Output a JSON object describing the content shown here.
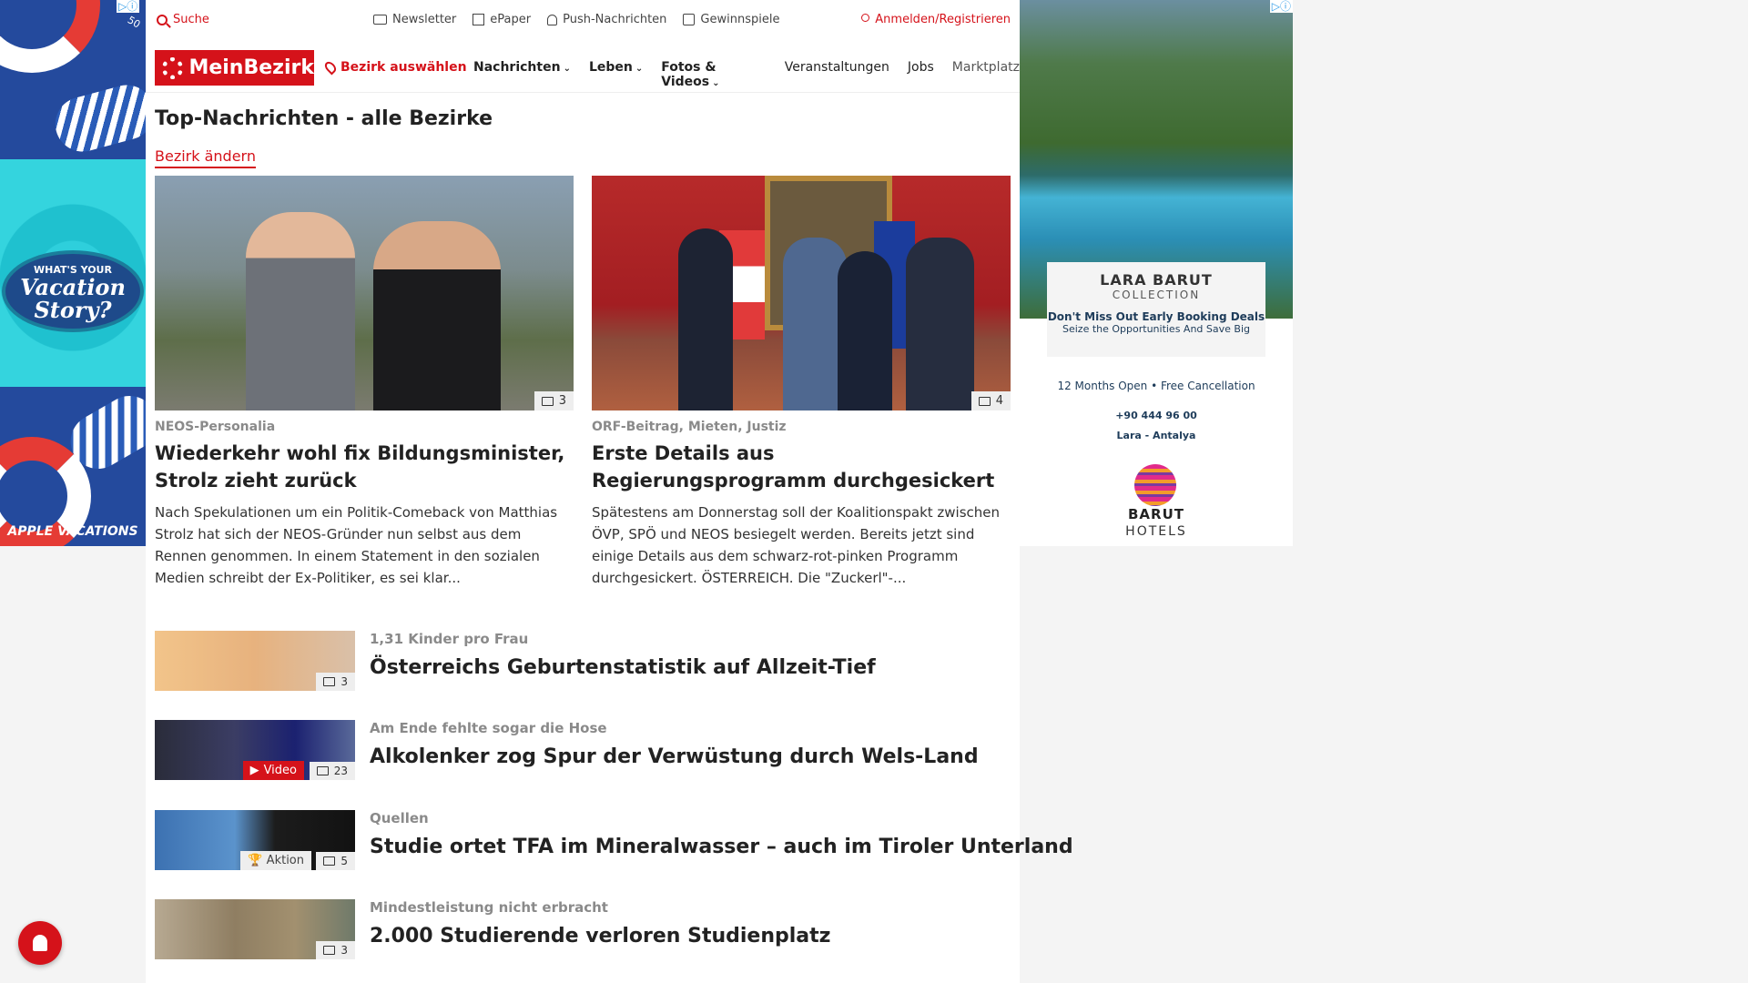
{
  "left_ad": {
    "tagline_small": "WHAT'S YOUR",
    "tagline_big1": "Vacation",
    "tagline_big2": "Story?",
    "brand": "APPLE VACATIONS",
    "badge": "50"
  },
  "topbar": {
    "search": "Suche",
    "newsletter": "Newsletter",
    "epaper": "ePaper",
    "push": "Push-Nachrichten",
    "gewinnspiele": "Gewinnspiele",
    "login": "Anmelden/Registrieren"
  },
  "navbar": {
    "logo": "MeinBezirk",
    "bezirk": "Bezirk auswählen",
    "menu": [
      "Nachrichten",
      "Leben",
      "Fotos & Videos",
      "Veranstaltungen",
      "Jobs",
      "Marktplatz"
    ]
  },
  "page": {
    "title": "Top-Nachrichten - alle Bezirke",
    "change_bezirk": "Bezirk ändern"
  },
  "featured": [
    {
      "kicker": "NEOS-Personalia",
      "title": "Wiederkehr wohl fix Bildungsminister, Strolz zieht zurück",
      "teaser": "Nach Spekulationen um ein Politik-Comeback von Matthias Strolz hat sich der NEOS-Gründer nun selbst aus dem Rennen genommen. In einem Statement in den sozialen Medien schreibt der Ex-Politiker, es sei klar...",
      "photos": "3"
    },
    {
      "kicker": "ORF-Beitrag, Mieten, Justiz",
      "title": "Erste Details aus Regierungsprogramm durchgesickert",
      "teaser": "Spätestens am Donnerstag soll der Koalitionspakt zwischen ÖVP, SPÖ und NEOS besiegelt werden. Bereits jetzt sind einige Details aus dem schwarz-rot-pinken Programm durchgesickert.  ÖSTERREICH. Die \"Zuckerl\"-...",
      "photos": "4"
    }
  ],
  "list": [
    {
      "kicker": "1,31 Kinder pro Frau",
      "title": "Österreichs Geburtenstatistik auf Allzeit-Tief",
      "photos": "3"
    },
    {
      "kicker": "Am Ende fehlte sogar die Hose",
      "title": "Alkolenker zog Spur der Verwüstung durch Wels-Land",
      "photos": "23",
      "video": "Video"
    },
    {
      "kicker": "Quellen",
      "title": "Studie ortet TFA im Mineralwasser – auch im Tiroler Unterland",
      "photos": "5",
      "aktion": "Aktion"
    },
    {
      "kicker": "Mindestleistung nicht erbracht",
      "title": "2.000 Studierende verloren Studienplatz",
      "photos": "3"
    }
  ],
  "right_ad": {
    "brand1": "LARA BARUT",
    "brand2": "COLLECTION",
    "deal": "Don't Miss Out Early Booking Deals",
    "deal2": "Seize the Opportunities And Save Big",
    "info": "12 Months Open  •  Free Cancellation",
    "phone": "+90 444 96 00",
    "location": "Lara - Antalya",
    "logo1": "BARUT",
    "logo2": "HOTELS"
  }
}
